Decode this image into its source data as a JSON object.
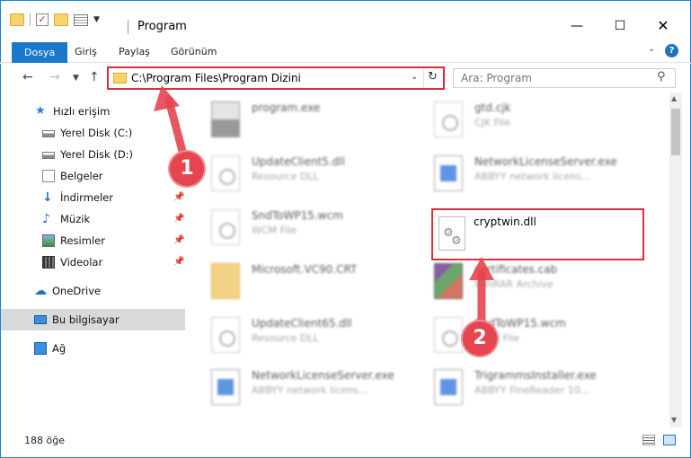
{
  "window": {
    "title": "Program",
    "minimize": "—",
    "maximize": "☐",
    "close": "✕"
  },
  "ribbon": {
    "tabs": [
      "Dosya",
      "Giriş",
      "Paylaş",
      "Görünüm"
    ]
  },
  "address": {
    "path": "C:\\Program Files\\Program Dizini"
  },
  "search": {
    "placeholder": "Ara: Program"
  },
  "sidebar": {
    "items": [
      {
        "label": "Hızlı erişim"
      },
      {
        "label": "Yerel Disk (C:)"
      },
      {
        "label": "Yerel Disk (D:)"
      },
      {
        "label": "Belgeler"
      },
      {
        "label": "İndirmeler"
      },
      {
        "label": "Müzik"
      },
      {
        "label": "Resimler"
      },
      {
        "label": "Videolar"
      },
      {
        "label": "OneDrive"
      },
      {
        "label": "Bu bilgisayar"
      },
      {
        "label": "Ağ"
      }
    ]
  },
  "files": [
    {
      "name": "program.exe",
      "type": ""
    },
    {
      "name": "gtd.cjk",
      "type": "CJK File"
    },
    {
      "name": "UpdateClient5.dll",
      "type": "Resource DLL"
    },
    {
      "name": "NetworkLicenseServer.exe",
      "type": "ABBYY network licens..."
    },
    {
      "name": "SndToWP15.wcm",
      "type": "WCM File"
    },
    {
      "name": "cryptwin.dll",
      "type": ""
    },
    {
      "name": "Microsoft.VC90.CRT",
      "type": ""
    },
    {
      "name": "certificates.cab",
      "type": "WinRAR Archive"
    },
    {
      "name": "UpdateClient65.dll",
      "type": "Resource DLL"
    },
    {
      "name": "SndToWP15.wcm",
      "type": "WCM File"
    },
    {
      "name": "NetworkLicenseServer.exe",
      "type": "ABBYY network licens..."
    },
    {
      "name": "TrigrammsInstaller.exe",
      "type": "ABBYY FineReader 10..."
    }
  ],
  "status": {
    "count": "188 öğe"
  },
  "annotations": {
    "step1": "1",
    "step2": "2",
    "color": "#e5454f"
  }
}
